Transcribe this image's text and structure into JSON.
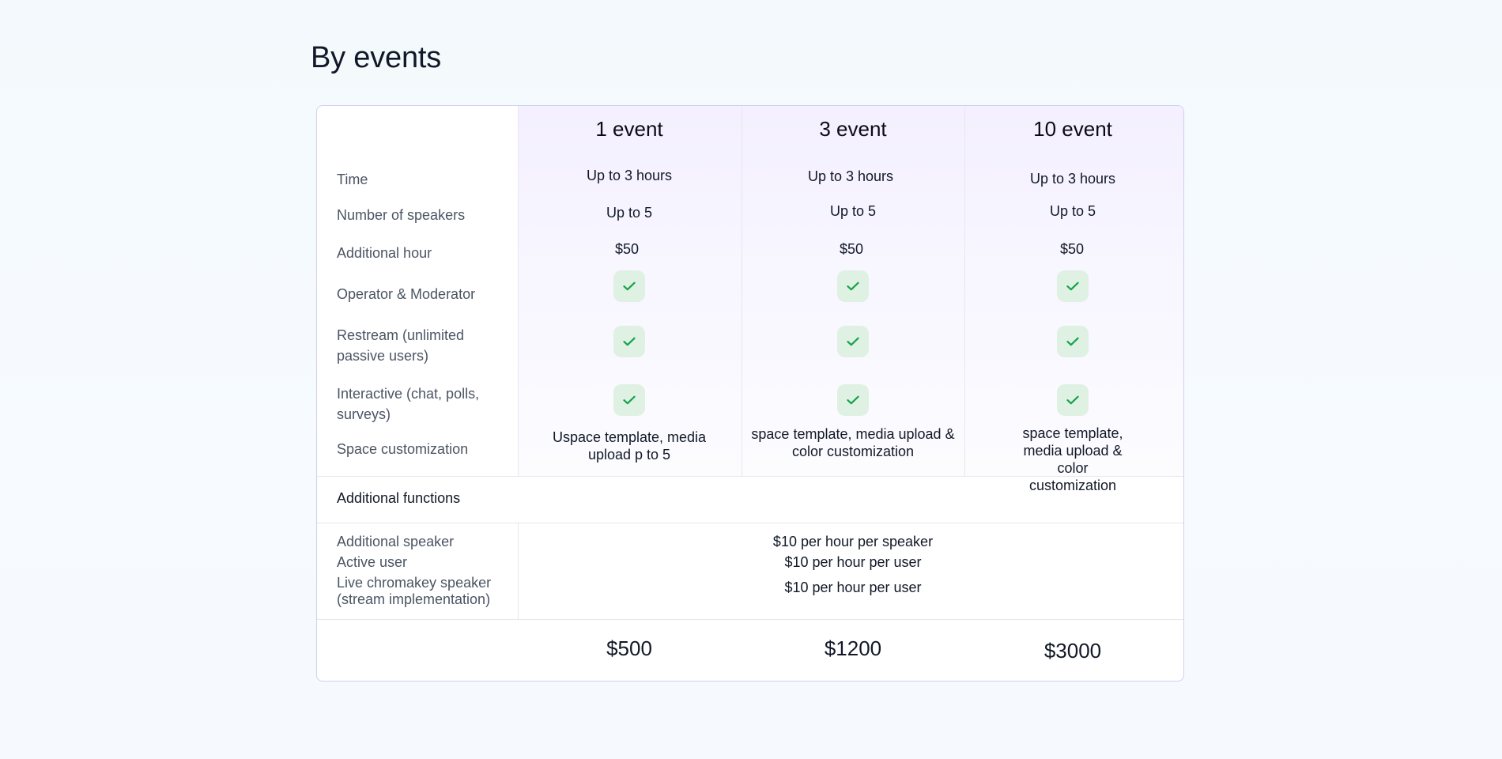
{
  "page": {
    "title": "By events"
  },
  "plans": [
    {
      "name": "1 event",
      "time": "Up to 3 hours",
      "speakers": "Up to 5",
      "additional_hour": "$50",
      "operator_moderator": true,
      "restream": true,
      "interactive": true,
      "space_customization_line1": "Uspace template, media",
      "space_customization_line2": "upload p to 5",
      "price": "$500"
    },
    {
      "name": "3 event",
      "time": "Up to 3 hours",
      "speakers": "Up to 5",
      "additional_hour": "$50",
      "operator_moderator": true,
      "restream": true,
      "interactive": true,
      "space_customization_line1": "space template, media upload &",
      "space_customization_line2": "color customization",
      "price": "$1200"
    },
    {
      "name": "10 event",
      "time": "Up to 3 hours",
      "speakers": "Up to 5",
      "additional_hour": "$50",
      "operator_moderator": true,
      "restream": true,
      "interactive": true,
      "space_customization_line1": "space template, media upload &",
      "space_customization_line2": "color customization",
      "price": "$3000"
    }
  ],
  "features": {
    "time": "Time",
    "speakers": "Number of speakers",
    "additional_hour": "Additional hour",
    "operator_moderator": "Operator & Moderator",
    "restream_line1": "Restream (unlimited",
    "restream_line2": "passive users)",
    "interactive_line1": "Interactive (chat, polls,",
    "interactive_line2": "surveys)",
    "space_customization": "Space customization"
  },
  "additional_functions": {
    "title": "Additional functions",
    "items": [
      {
        "label": "Additional speaker",
        "value": "$10 per hour per speaker"
      },
      {
        "label": "Active user",
        "value": "$10 per hour per user"
      },
      {
        "label_line1": "Live chromakey speaker",
        "label_line2": "(stream implementation)",
        "value": "$10 per hour per user"
      }
    ]
  },
  "colors": {
    "check_bg": "#dff1e3",
    "check_mark": "#16a34a",
    "border": "#cfd0f0",
    "plan_header_bg": "#f4f0ff"
  },
  "icons": {
    "included": "check-icon"
  }
}
